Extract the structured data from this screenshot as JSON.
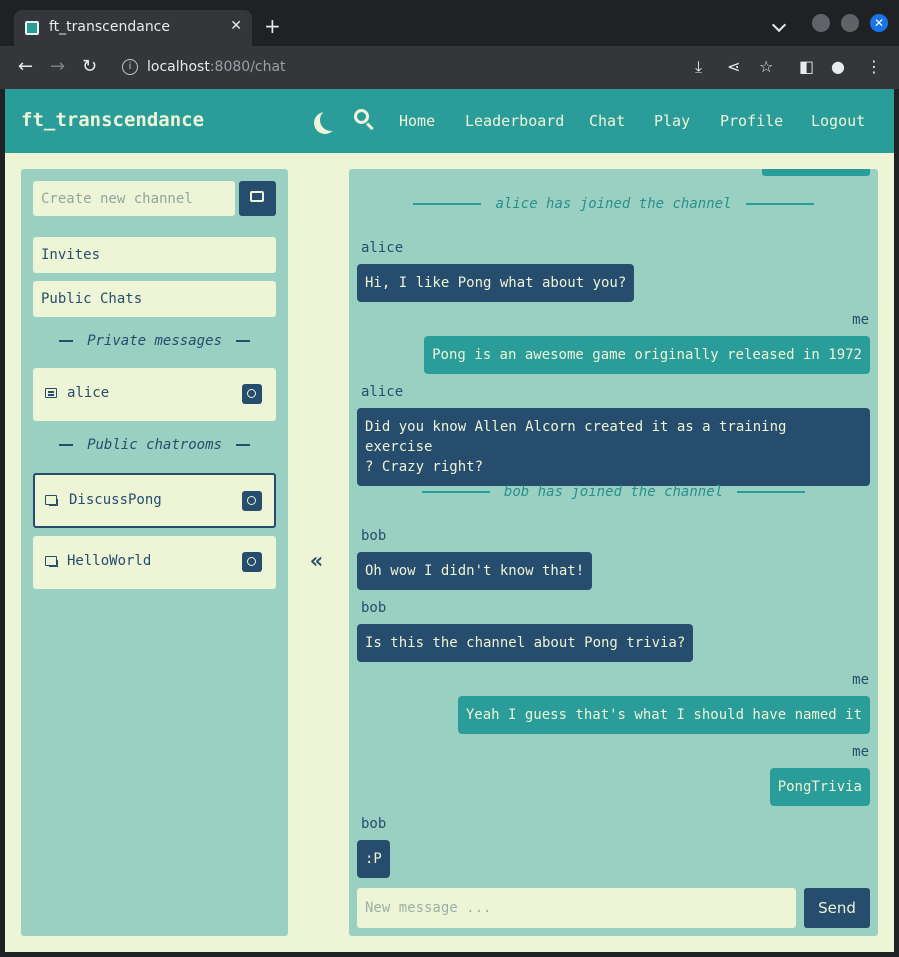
{
  "browser": {
    "tab_title": "ft_transcendance",
    "tab_close": "✕",
    "new_tab": "+",
    "url_host": "localhost",
    "url_rest": ":8080/chat"
  },
  "navbar": {
    "brand": "ft_transcendance",
    "links": [
      "Home",
      "Leaderboard",
      "Chat",
      "Play",
      "Profile",
      "Logout"
    ]
  },
  "sidebar": {
    "channel_placeholder": "Create new channel",
    "invites": "Invites",
    "public_chats": "Public Chats",
    "private_header": "Private messages",
    "private_items": [
      "alice"
    ],
    "public_header": "Public chatrooms",
    "public_items": [
      "DiscussPong",
      "HelloWorld"
    ],
    "collapse": "«"
  },
  "chat": {
    "system_1": "alice has joined the channel",
    "system_2": "bob has joined the channel",
    "messages": [
      {
        "sender": "alice",
        "text": "Hi, I like Pong what about you?"
      },
      {
        "sender": "me",
        "text": "Pong is an awesome game originally released in 1972"
      },
      {
        "sender": "alice",
        "text": "Did you know Allen Alcorn created it as a training exercise\n? Crazy right?"
      },
      {
        "sender": "bob",
        "text": "Oh wow I didn't know that!"
      },
      {
        "sender": "bob",
        "text": "Is this the channel about Pong trivia?"
      },
      {
        "sender": "me",
        "text": "Yeah I guess that's what I should have named it"
      },
      {
        "sender": "me",
        "text": "PongTrivia"
      },
      {
        "sender": "bob",
        "text": ":P"
      }
    ],
    "input_placeholder": "New message ...",
    "send_label": "Send"
  },
  "colors": {
    "teal": "#2a9d9b",
    "navy": "#264c6e",
    "cream": "#eef4d6",
    "panel": "#9ad0c2"
  }
}
